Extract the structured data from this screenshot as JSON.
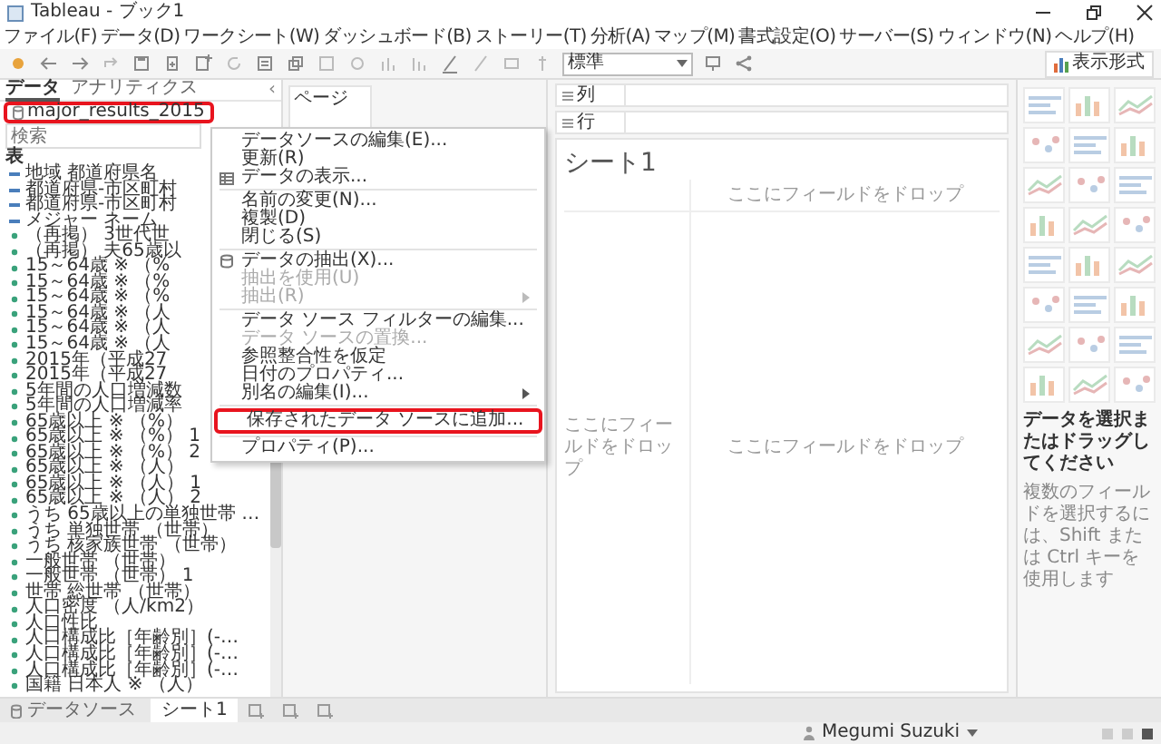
{
  "window": {
    "title": "Tableau - ブック1"
  },
  "menu_bar": [
    "ファイル(F)",
    "データ(D)",
    "ワークシート(W)",
    "ダッシュボード(B)",
    "ストーリー(T)",
    "分析(A)",
    "マップ(M)",
    "書式設定(O)",
    "サーバー(S)",
    "ウィンドウ(N)",
    "ヘルプ(H)"
  ],
  "toolbar": {
    "view_dropdown": "標準",
    "show_me_button": "表示形式"
  },
  "data_pane": {
    "tabs": [
      {
        "label": "データ",
        "selected": true
      },
      {
        "label": "アナリティクス",
        "selected": false
      }
    ],
    "collapse": "‹",
    "data_source": {
      "name": "major_results_2015",
      "highlighted": true
    },
    "search": {
      "placeholder": "検索"
    },
    "section": "表",
    "fields": [
      {
        "label": "地域 都道府県名",
        "kind": "dimension"
      },
      {
        "label": "都道府県-市区町村",
        "kind": "dimension"
      },
      {
        "label": "都道府県-市区町村",
        "kind": "dimension"
      },
      {
        "label": "メジャー ネーム",
        "kind": "dimension"
      },
      {
        "label": "（再掲） 3世代世",
        "kind": "measure"
      },
      {
        "label": "（再掲） 夫65歳以",
        "kind": "measure"
      },
      {
        "label": "15～64歳 ※ （%",
        "kind": "measure"
      },
      {
        "label": "15～64歳 ※ （%",
        "kind": "measure"
      },
      {
        "label": "15～64歳 ※ （%",
        "kind": "measure"
      },
      {
        "label": "15～64歳 ※ （人",
        "kind": "measure"
      },
      {
        "label": "15～64歳 ※ （人",
        "kind": "measure"
      },
      {
        "label": "15～64歳 ※ （人",
        "kind": "measure"
      },
      {
        "label": "2015年（平成27",
        "kind": "measure"
      },
      {
        "label": "2015年（平成27",
        "kind": "measure"
      },
      {
        "label": "5年間の人口増減数",
        "kind": "measure"
      },
      {
        "label": "5年間の人口増減率",
        "kind": "measure"
      },
      {
        "label": "65歳以上 ※ （%）",
        "kind": "measure"
      },
      {
        "label": "65歳以上 ※ （%） 1",
        "kind": "measure"
      },
      {
        "label": "65歳以上 ※ （%） 2",
        "kind": "measure"
      },
      {
        "label": "65歳以上 ※ （人）",
        "kind": "measure"
      },
      {
        "label": "65歳以上 ※ （人） 1",
        "kind": "measure"
      },
      {
        "label": "65歳以上 ※ （人） 2",
        "kind": "measure"
      },
      {
        "label": "うち 65歳以上の単独世帯 …",
        "kind": "measure"
      },
      {
        "label": "うち 単独世帯 （世帯）",
        "kind": "measure"
      },
      {
        "label": "うち 核家族世帯 （世帯）",
        "kind": "measure"
      },
      {
        "label": "一般世帯 （世帯）",
        "kind": "measure"
      },
      {
        "label": "一般世帯 （世帯） 1",
        "kind": "measure"
      },
      {
        "label": "世帯 総世帯 （世帯）",
        "kind": "measure"
      },
      {
        "label": "人口密度 （人/km2）",
        "kind": "measure"
      },
      {
        "label": "人口性比",
        "kind": "measure"
      },
      {
        "label": "人口構成比［年齢別］(-…",
        "kind": "measure"
      },
      {
        "label": "人口構成比［年齢別］(-…",
        "kind": "measure"
      },
      {
        "label": "人口構成比［年齢別］(-…",
        "kind": "measure"
      },
      {
        "label": "国籍 日本人 ※ （人）",
        "kind": "measure"
      }
    ]
  },
  "pages_pane": {
    "title": "ページ"
  },
  "shelves": [
    {
      "label": "列"
    },
    {
      "label": "行"
    }
  ],
  "sheet": {
    "title": "シート1",
    "drop_column": "ここにフィールドをドロップ",
    "drop_row": "ここにフィールドをドロップ",
    "drop_center": "ここにフィールドをドロップ"
  },
  "context_menu": {
    "items": [
      {
        "kind": "item",
        "label": "データソースの編集(E)...",
        "disabled": false,
        "submenu": false,
        "highlighted": false
      },
      {
        "kind": "item",
        "label": "更新(R)",
        "disabled": false,
        "submenu": false,
        "highlighted": false
      },
      {
        "kind": "table",
        "label": "データの表示...",
        "disabled": false,
        "submenu": false,
        "highlighted": false
      },
      {
        "kind": "separator"
      },
      {
        "kind": "item",
        "label": "名前の変更(N)...",
        "disabled": false,
        "submenu": false,
        "highlighted": false
      },
      {
        "kind": "item",
        "label": "複製(D)",
        "disabled": false,
        "submenu": false,
        "highlighted": false
      },
      {
        "kind": "item",
        "label": "閉じる(S)",
        "disabled": false,
        "submenu": false,
        "highlighted": false
      },
      {
        "kind": "separator"
      },
      {
        "kind": "extract",
        "label": "データの抽出(X)...",
        "disabled": false,
        "submenu": false,
        "highlighted": false
      },
      {
        "kind": "item",
        "label": "抽出を使用(U)",
        "disabled": true,
        "submenu": false,
        "highlighted": false
      },
      {
        "kind": "item",
        "label": "抽出(R)",
        "disabled": true,
        "submenu": true,
        "highlighted": false
      },
      {
        "kind": "separator"
      },
      {
        "kind": "item",
        "label": "データ ソース フィルターの編集...",
        "disabled": false,
        "submenu": false,
        "highlighted": false
      },
      {
        "kind": "item",
        "label": "データ ソースの置換...",
        "disabled": true,
        "submenu": false,
        "highlighted": false
      },
      {
        "kind": "item",
        "label": "参照整合性を仮定",
        "disabled": false,
        "submenu": false,
        "highlighted": false
      },
      {
        "kind": "item",
        "label": "日付のプロパティ...",
        "disabled": false,
        "submenu": false,
        "highlighted": false
      },
      {
        "kind": "item",
        "label": "別名の編集(I)...",
        "disabled": false,
        "submenu": true,
        "highlighted": false
      },
      {
        "kind": "separator"
      },
      {
        "kind": "item",
        "label": "保存されたデータ ソースに追加...",
        "disabled": false,
        "submenu": false,
        "highlighted": true
      },
      {
        "kind": "separator"
      },
      {
        "kind": "item",
        "label": "プロパティ(P)...",
        "disabled": false,
        "submenu": false,
        "highlighted": false
      }
    ]
  },
  "show_me": {
    "hint_title": "データを選択またはドラッグしてください",
    "hint_text": "複数のフィールドを選択するには、Shift または Ctrl キーを使用します"
  },
  "sheet_tabs": [
    {
      "label": "データソース",
      "kind": "data_source",
      "selected": false
    },
    {
      "label": "シート1",
      "kind": "sheet",
      "selected": true
    }
  ],
  "status_bar": {
    "user": "Megumi Suzuki"
  }
}
